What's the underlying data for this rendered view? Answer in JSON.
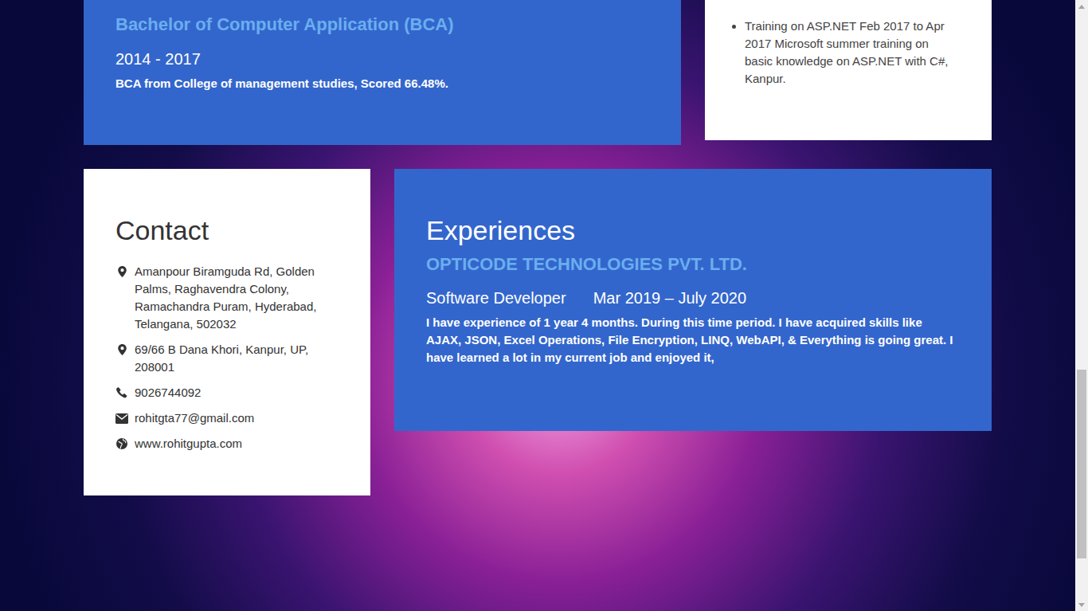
{
  "education": {
    "degree": "Bachelor of Computer Application (BCA)",
    "years": "2014 - 2017",
    "description": "BCA from College of management studies, Scored 66.48%."
  },
  "training": {
    "items": [
      "Training on ASP.NET Feb 2017 to Apr 2017 Microsoft summer training on basic knowledge on ASP.NET with C#, Kanpur."
    ]
  },
  "contact": {
    "title": "Contact",
    "items": [
      {
        "kind": "address",
        "text": "Amanpour Biramguda Rd, Golden Palms, Raghavendra Colony, Ramachandra Puram, Hyderabad, Telangana, 502032"
      },
      {
        "kind": "address",
        "text": "69/66 B Dana Khori, Kanpur, UP, 208001"
      },
      {
        "kind": "phone",
        "text": "9026744092"
      },
      {
        "kind": "email",
        "text": "rohitgta77@gmail.com"
      },
      {
        "kind": "website",
        "text": "www.rohitgupta.com"
      }
    ]
  },
  "experiences": {
    "title": "Experiences",
    "jobs": [
      {
        "company": "OPTICODE TECHNOLOGIES PVT. LTD.",
        "role": "Software Developer",
        "period": "Mar 2019 – July 2020",
        "description": "I have experience of 1 year 4 months. During this time period. I have acquired skills like AJAX, JSON, Excel Operations, File Encryption, LINQ, WebAPI, & Everything is going great. I have learned a lot in my current job and enjoyed it,"
      }
    ]
  },
  "scrollbar": {
    "level": 0.9
  }
}
